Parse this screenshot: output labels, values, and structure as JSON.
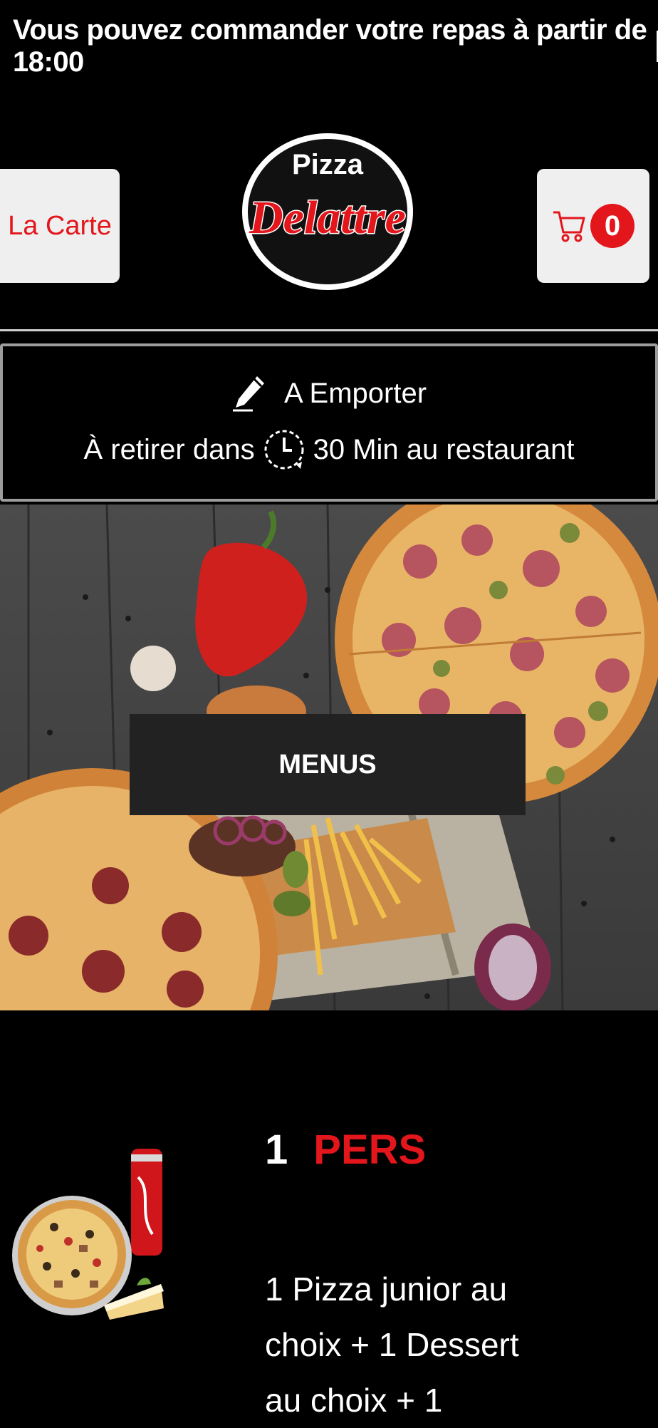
{
  "banner": {
    "text": "Vous pouvez commander votre repas à partir de 18:00"
  },
  "header": {
    "carte_label": "La Carte",
    "logo_top": "Pizza",
    "logo_main": "Delattre",
    "cart_count": "0"
  },
  "takeaway": {
    "mode_label": "A Emporter",
    "pickup_prefix": "À retirer dans",
    "pickup_suffix": "30 Min au restaurant"
  },
  "hero": {
    "button_label": "MENUS"
  },
  "offer": {
    "count": "1",
    "unit": "PERS",
    "description": "1 Pizza junior au choix + 1 Dessert au choix + 1"
  },
  "colors": {
    "accent": "#e3161c",
    "background": "#000000",
    "button_bg": "#efefef"
  }
}
